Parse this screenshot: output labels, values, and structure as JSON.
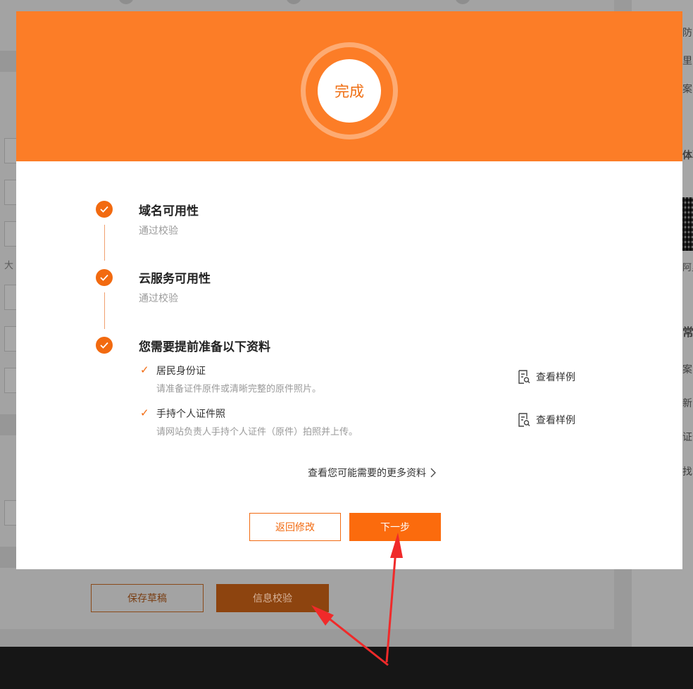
{
  "background": {
    "right_panel_lines": [
      "防",
      "里",
      "案",
      "体验",
      "阿里",
      "常见",
      "案",
      "新的",
      "证件",
      "找"
    ],
    "left_field_chars": [
      "大"
    ],
    "save_draft_label": "保存草稿",
    "info_verify_label": "信息校验"
  },
  "modal": {
    "status_text": "完成",
    "steps": [
      {
        "title": "域名可用性",
        "subtitle": "通过校验"
      },
      {
        "title": "云服务可用性",
        "subtitle": "通过校验"
      },
      {
        "title": "您需要提前准备以下资料",
        "subtitle": ""
      }
    ],
    "requirements": [
      {
        "title": "居民身份证",
        "desc": "请准备证件原件或清晰完整的原件照片。",
        "link": "查看样例"
      },
      {
        "title": "手持个人证件照",
        "desc": "请网站负责人手持个人证件（原件）拍照并上传。",
        "link": "查看样例"
      }
    ],
    "more_link": "查看您可能需要的更多资料",
    "back_label": "返回修改",
    "next_label": "下一步"
  },
  "colors": {
    "accent": "#fc7d27",
    "button_orange": "#fb6b0d",
    "annotation_red": "#f02a2a"
  }
}
